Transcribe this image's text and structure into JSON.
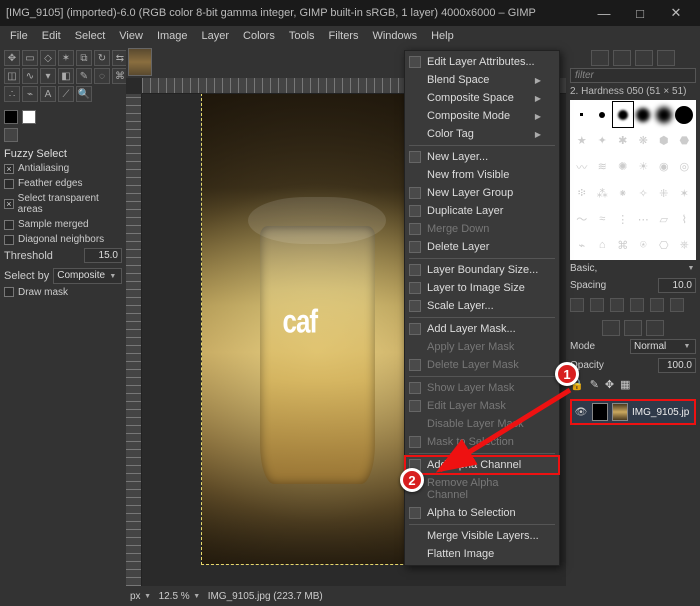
{
  "titlebar": {
    "title": "[IMG_9105] (imported)-6.0 (RGB color 8-bit gamma integer, GIMP built-in sRGB, 1 layer) 4000x6000 – GIMP"
  },
  "win": {
    "min": "—",
    "max": "□",
    "close": "✕"
  },
  "menubar": [
    "File",
    "Edit",
    "Select",
    "View",
    "Image",
    "Layer",
    "Colors",
    "Tools",
    "Filters",
    "Windows",
    "Help"
  ],
  "toolopts": {
    "title": "Fuzzy Select",
    "antialias": "Antialiasing",
    "feather": "Feather edges",
    "transp": "Select transparent areas",
    "merged": "Sample merged",
    "diag": "Diagonal neighbors",
    "threshold_label": "Threshold",
    "threshold_val": "15.0",
    "selectby": "Select by",
    "selectby_val": "Composite",
    "drawmask": "Draw mask"
  },
  "status": {
    "unit": "px",
    "zoom": "12.5 %",
    "file": "IMG_9105.jpg (223.7 MB)"
  },
  "rpanel": {
    "filter": "filter",
    "brush": "2. Hardness 050 (51 × 51)",
    "preset": "Basic,",
    "spacing": "Spacing",
    "spacing_val": "10.0",
    "mode": "Mode",
    "mode_val": "Normal",
    "opacity": "Opacity",
    "opacity_val": "100.0",
    "layer": "IMG_9105.jp"
  },
  "ctx": {
    "edit": "Edit Layer Attributes...",
    "blend": "Blend Space",
    "comp": "Composite Space",
    "compm": "Composite Mode",
    "ctag": "Color Tag",
    "newl": "New Layer...",
    "newvis": "New from Visible",
    "newgrp": "New Layer Group",
    "dup": "Duplicate Layer",
    "mdown": "Merge Down",
    "dele": "Delete Layer",
    "lbs": "Layer Boundary Size...",
    "lis": "Layer to Image Size",
    "scl": "Scale Layer...",
    "addm": "Add Layer Mask...",
    "appm": "Apply Layer Mask",
    "delm": "Delete Layer Mask",
    "showm": "Show Layer Mask",
    "editm": "Edit Layer Mask",
    "dism": "Disable Layer Mask",
    "m2s": "Mask to Selection",
    "addalpha": "Add Alpha Channel",
    "remalpha": "Remove Alpha Channel",
    "a2s": "Alpha to Selection",
    "mvis": "Merge Visible Layers...",
    "flat": "Flatten Image"
  },
  "canvas_text": "caf",
  "markers": {
    "one": "1",
    "two": "2"
  }
}
